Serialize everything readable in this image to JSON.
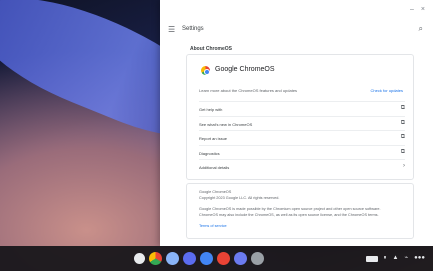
{
  "window": {
    "title": "Settings",
    "controls": [
      "–",
      "×"
    ]
  },
  "section_title": "About ChromeOS",
  "card": {
    "product_name": "Google ChromeOS",
    "help_text": "Learn more about the ChromeOS features and updates",
    "check_updates": "Check for updates",
    "rows": [
      {
        "label": "Get help with",
        "icon": "external-link-icon"
      },
      {
        "label": "See what's new in ChromeOS",
        "icon": "external-link-icon"
      },
      {
        "label": "Report an issue",
        "icon": "external-link-icon"
      },
      {
        "label": "Diagnostics",
        "icon": "external-link-icon"
      },
      {
        "label": "Additional details",
        "icon": "chevron-right-icon"
      }
    ]
  },
  "info": {
    "line1": "Google ChromeOS",
    "line2": "Copyright 2023 Google LLC. All rights reserved.",
    "line3": "Google ChromeOS is made possible by the Chromium open source project and other open source software.",
    "line4": "ChromeOS may also include the ChromeOS, as well as its open source license, and the ChromeOS terms.",
    "line5": "Terms of service"
  },
  "shelf": {
    "apps": [
      {
        "name": "launcher",
        "color": "#e8eaed"
      },
      {
        "name": "chrome",
        "color": "#f2b600"
      },
      {
        "name": "files",
        "color": "#8ab4f8"
      },
      {
        "name": "meet",
        "color": "#5b6cf0"
      },
      {
        "name": "settings",
        "color": "#4285f4"
      },
      {
        "name": "youtube",
        "color": "#ea4335"
      },
      {
        "name": "camera",
        "color": "#6b7bf0"
      },
      {
        "name": "play",
        "color": "#9aa0a6"
      }
    ],
    "tray": [
      "▮▮",
      "⏸",
      "▲",
      "⌁",
      "●●●"
    ]
  }
}
